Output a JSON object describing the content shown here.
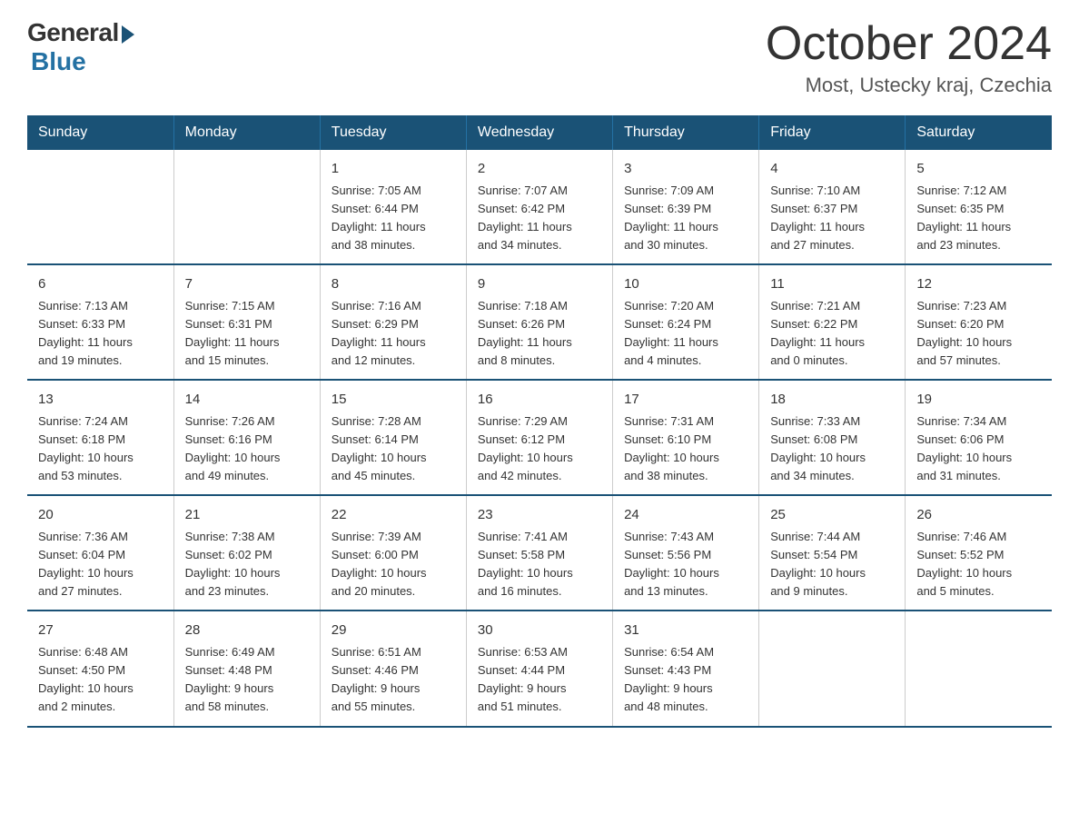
{
  "logo": {
    "general": "General",
    "blue": "Blue"
  },
  "header": {
    "month": "October 2024",
    "location": "Most, Ustecky kraj, Czechia"
  },
  "weekdays": [
    "Sunday",
    "Monday",
    "Tuesday",
    "Wednesday",
    "Thursday",
    "Friday",
    "Saturday"
  ],
  "rows": [
    [
      {
        "day": "",
        "info": ""
      },
      {
        "day": "",
        "info": ""
      },
      {
        "day": "1",
        "info": "Sunrise: 7:05 AM\nSunset: 6:44 PM\nDaylight: 11 hours\nand 38 minutes."
      },
      {
        "day": "2",
        "info": "Sunrise: 7:07 AM\nSunset: 6:42 PM\nDaylight: 11 hours\nand 34 minutes."
      },
      {
        "day": "3",
        "info": "Sunrise: 7:09 AM\nSunset: 6:39 PM\nDaylight: 11 hours\nand 30 minutes."
      },
      {
        "day": "4",
        "info": "Sunrise: 7:10 AM\nSunset: 6:37 PM\nDaylight: 11 hours\nand 27 minutes."
      },
      {
        "day": "5",
        "info": "Sunrise: 7:12 AM\nSunset: 6:35 PM\nDaylight: 11 hours\nand 23 minutes."
      }
    ],
    [
      {
        "day": "6",
        "info": "Sunrise: 7:13 AM\nSunset: 6:33 PM\nDaylight: 11 hours\nand 19 minutes."
      },
      {
        "day": "7",
        "info": "Sunrise: 7:15 AM\nSunset: 6:31 PM\nDaylight: 11 hours\nand 15 minutes."
      },
      {
        "day": "8",
        "info": "Sunrise: 7:16 AM\nSunset: 6:29 PM\nDaylight: 11 hours\nand 12 minutes."
      },
      {
        "day": "9",
        "info": "Sunrise: 7:18 AM\nSunset: 6:26 PM\nDaylight: 11 hours\nand 8 minutes."
      },
      {
        "day": "10",
        "info": "Sunrise: 7:20 AM\nSunset: 6:24 PM\nDaylight: 11 hours\nand 4 minutes."
      },
      {
        "day": "11",
        "info": "Sunrise: 7:21 AM\nSunset: 6:22 PM\nDaylight: 11 hours\nand 0 minutes."
      },
      {
        "day": "12",
        "info": "Sunrise: 7:23 AM\nSunset: 6:20 PM\nDaylight: 10 hours\nand 57 minutes."
      }
    ],
    [
      {
        "day": "13",
        "info": "Sunrise: 7:24 AM\nSunset: 6:18 PM\nDaylight: 10 hours\nand 53 minutes."
      },
      {
        "day": "14",
        "info": "Sunrise: 7:26 AM\nSunset: 6:16 PM\nDaylight: 10 hours\nand 49 minutes."
      },
      {
        "day": "15",
        "info": "Sunrise: 7:28 AM\nSunset: 6:14 PM\nDaylight: 10 hours\nand 45 minutes."
      },
      {
        "day": "16",
        "info": "Sunrise: 7:29 AM\nSunset: 6:12 PM\nDaylight: 10 hours\nand 42 minutes."
      },
      {
        "day": "17",
        "info": "Sunrise: 7:31 AM\nSunset: 6:10 PM\nDaylight: 10 hours\nand 38 minutes."
      },
      {
        "day": "18",
        "info": "Sunrise: 7:33 AM\nSunset: 6:08 PM\nDaylight: 10 hours\nand 34 minutes."
      },
      {
        "day": "19",
        "info": "Sunrise: 7:34 AM\nSunset: 6:06 PM\nDaylight: 10 hours\nand 31 minutes."
      }
    ],
    [
      {
        "day": "20",
        "info": "Sunrise: 7:36 AM\nSunset: 6:04 PM\nDaylight: 10 hours\nand 27 minutes."
      },
      {
        "day": "21",
        "info": "Sunrise: 7:38 AM\nSunset: 6:02 PM\nDaylight: 10 hours\nand 23 minutes."
      },
      {
        "day": "22",
        "info": "Sunrise: 7:39 AM\nSunset: 6:00 PM\nDaylight: 10 hours\nand 20 minutes."
      },
      {
        "day": "23",
        "info": "Sunrise: 7:41 AM\nSunset: 5:58 PM\nDaylight: 10 hours\nand 16 minutes."
      },
      {
        "day": "24",
        "info": "Sunrise: 7:43 AM\nSunset: 5:56 PM\nDaylight: 10 hours\nand 13 minutes."
      },
      {
        "day": "25",
        "info": "Sunrise: 7:44 AM\nSunset: 5:54 PM\nDaylight: 10 hours\nand 9 minutes."
      },
      {
        "day": "26",
        "info": "Sunrise: 7:46 AM\nSunset: 5:52 PM\nDaylight: 10 hours\nand 5 minutes."
      }
    ],
    [
      {
        "day": "27",
        "info": "Sunrise: 6:48 AM\nSunset: 4:50 PM\nDaylight: 10 hours\nand 2 minutes."
      },
      {
        "day": "28",
        "info": "Sunrise: 6:49 AM\nSunset: 4:48 PM\nDaylight: 9 hours\nand 58 minutes."
      },
      {
        "day": "29",
        "info": "Sunrise: 6:51 AM\nSunset: 4:46 PM\nDaylight: 9 hours\nand 55 minutes."
      },
      {
        "day": "30",
        "info": "Sunrise: 6:53 AM\nSunset: 4:44 PM\nDaylight: 9 hours\nand 51 minutes."
      },
      {
        "day": "31",
        "info": "Sunrise: 6:54 AM\nSunset: 4:43 PM\nDaylight: 9 hours\nand 48 minutes."
      },
      {
        "day": "",
        "info": ""
      },
      {
        "day": "",
        "info": ""
      }
    ]
  ]
}
